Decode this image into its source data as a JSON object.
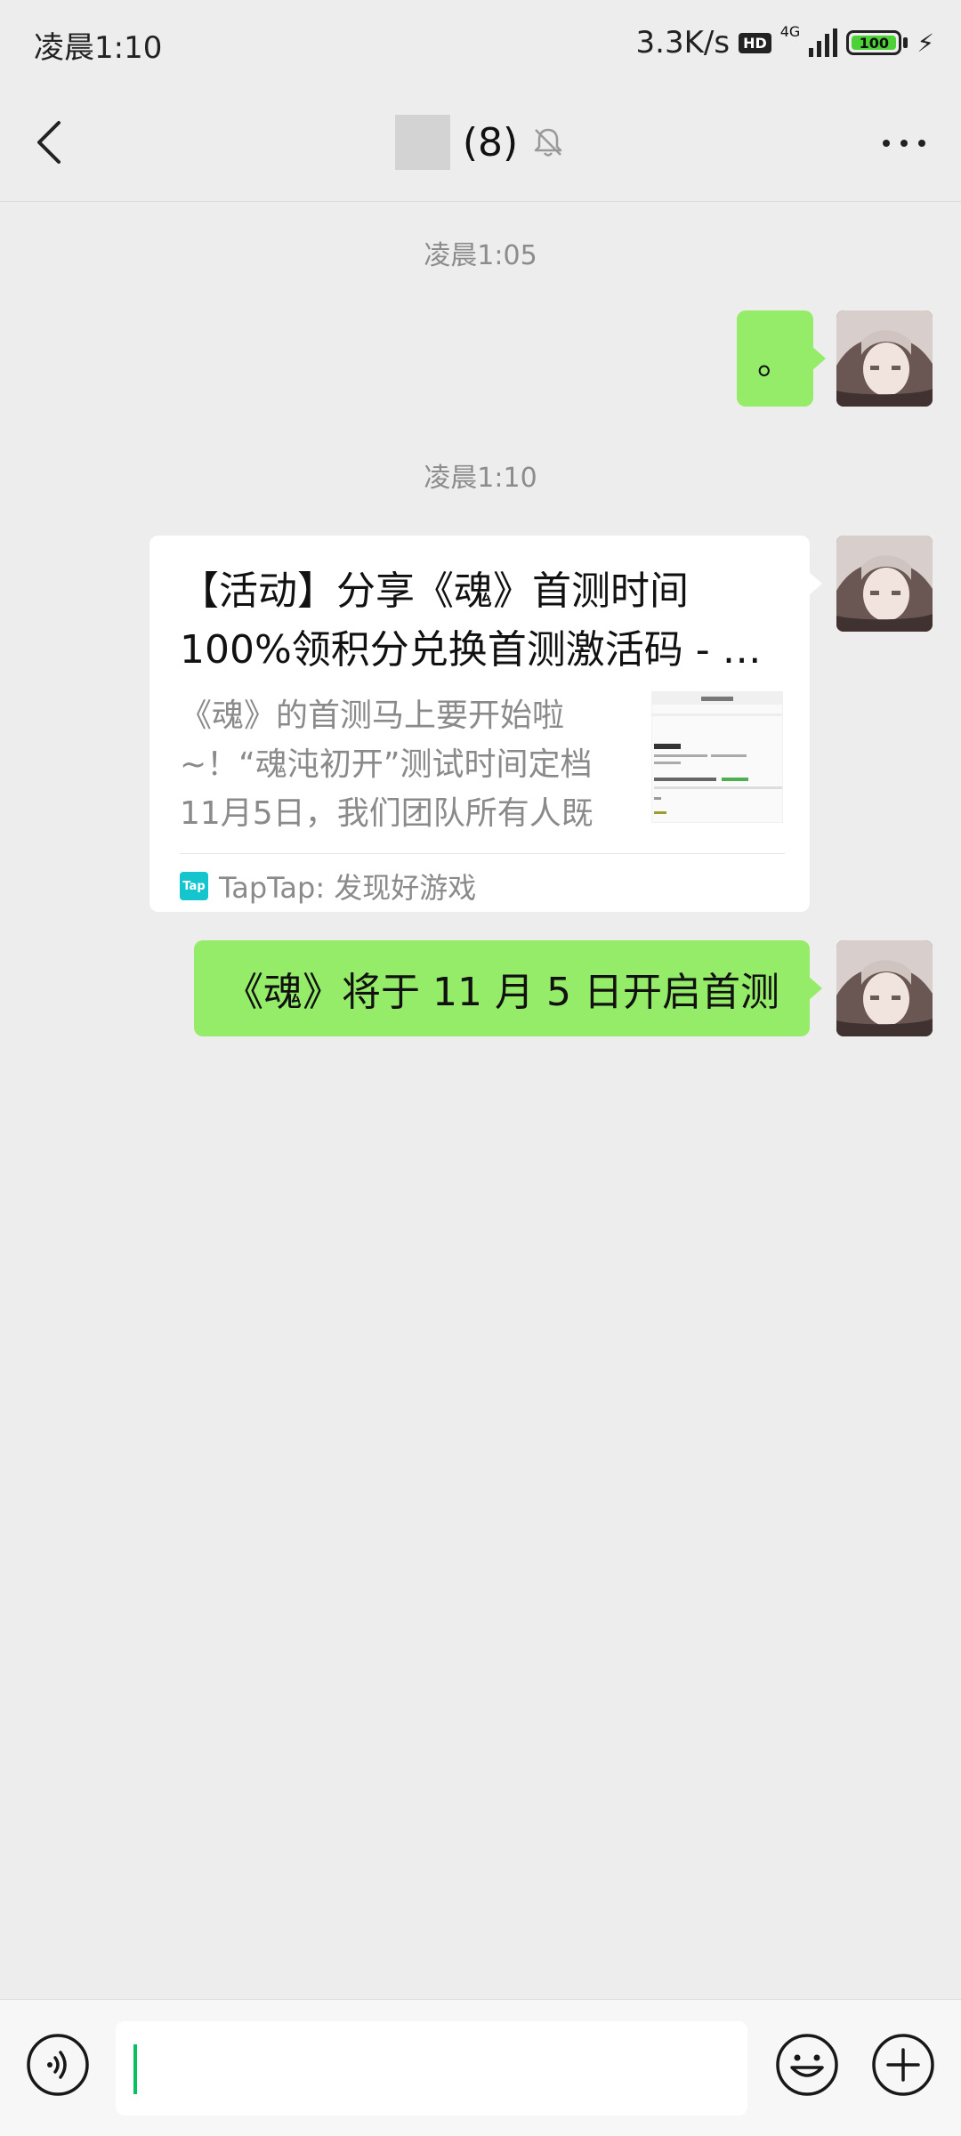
{
  "status_bar": {
    "time": "凌晨1:10",
    "net_speed": "3.3K/s",
    "hd": "HD",
    "network": "4G",
    "battery": "100"
  },
  "header": {
    "title": "(8)",
    "back_icon": "chevron-left-icon",
    "mute_icon": "bell-off-icon",
    "more_icon": "ellipsis-icon"
  },
  "messages": {
    "timestamp1": "凌晨1:05",
    "msg1_text": "。",
    "timestamp2": "凌晨1:10",
    "card": {
      "title": "【活动】分享《魂》首测时间100%领积分兑换首测激活码 - …",
      "description": "《魂》的首测马上要开始啦~！“魂沌初开”测试时间定档11月5日，我们团队所有人既兴…",
      "source": "TapTap: 发现好游戏",
      "source_logo": "Tap"
    },
    "msg2_text": "《魂》将于 11 月 5 日开启首测"
  },
  "input_bar": {
    "value": "",
    "voice_icon": "voice-icon",
    "emoji_icon": "emoji-icon",
    "plus_icon": "plus-icon"
  },
  "colors": {
    "background": "#ededed",
    "bubble_green": "#95ec69",
    "caret_green": "#07c160"
  }
}
